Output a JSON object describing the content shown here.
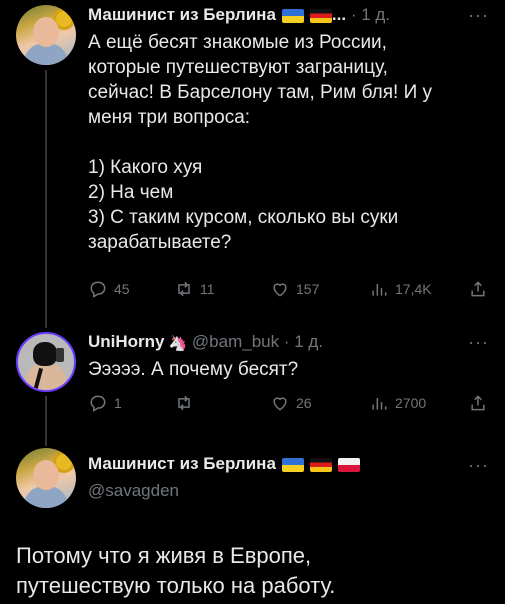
{
  "tweets": [
    {
      "name": "Машинист из Берлина",
      "name_suffix": "...",
      "handle": "",
      "time": "· 1 д.",
      "text": "А ещё бесят знакомые из России,\nкоторые путешествуют заграницу,\nсейчас! В Барселону там, Рим бля! И у\nменя три вопроса:\n\n1) Какого хуя\n2) На чем\n3) С таким курсом, сколько вы суки\nзарабатываете?",
      "stats": {
        "replies": "45",
        "retweets": "11",
        "likes": "157",
        "views": "17,4K"
      }
    },
    {
      "name": "UniHorny",
      "handle": "@bam_buk",
      "time": "· 1 д.",
      "text": "Эээээ. А почему бесят?",
      "stats": {
        "replies": "1",
        "retweets": "",
        "likes": "26",
        "views": "2700"
      }
    },
    {
      "name": "Машинист из Берлина",
      "handle": "@savagden",
      "text": "Потому что я живя в Европе,\nпутешествую только на работу."
    }
  ],
  "icons": [
    "reply-icon",
    "retweet-icon",
    "like-icon",
    "views-icon",
    "share-icon",
    "more-icon"
  ],
  "colors": {
    "background": "#000000",
    "text": "#e7e9ea",
    "muted": "#71767b",
    "thread_line": "#333639"
  }
}
